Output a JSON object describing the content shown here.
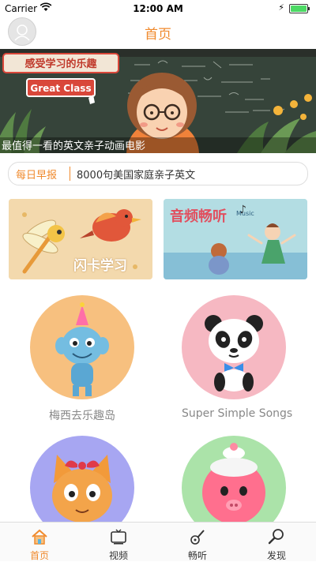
{
  "status_bar": {
    "carrier": "Carrier",
    "time": "12:00 AM"
  },
  "nav": {
    "title": "首页"
  },
  "banner": {
    "sign_top": "感受学习的乐趣",
    "sign_bottom": "Great Class",
    "caption": "最值得一看的英文亲子动画电影"
  },
  "news": {
    "tag": "每日早报",
    "text": "8000句美国家庭亲子英文"
  },
  "cards": [
    {
      "label": "闪卡学习"
    },
    {
      "label": "音频畅听",
      "sublabel": "Music"
    }
  ],
  "series": [
    {
      "label": "梅西去乐趣岛",
      "bg": "#f7c07f"
    },
    {
      "label": "Super Simple Songs",
      "bg": "#f6b8c2"
    },
    {
      "label": "",
      "bg": "#a7a6f2"
    },
    {
      "label": "",
      "bg": "#abe3a9"
    }
  ],
  "tabbar": {
    "active": 0,
    "items": [
      {
        "label": "首页",
        "icon": "home-icon"
      },
      {
        "label": "视频",
        "icon": "tv-icon"
      },
      {
        "label": "畅听",
        "icon": "guitar-icon"
      },
      {
        "label": "发现",
        "icon": "magnifier-icon"
      }
    ]
  },
  "colors": {
    "accent": "#f08a2d",
    "label_gray": "#888888"
  }
}
